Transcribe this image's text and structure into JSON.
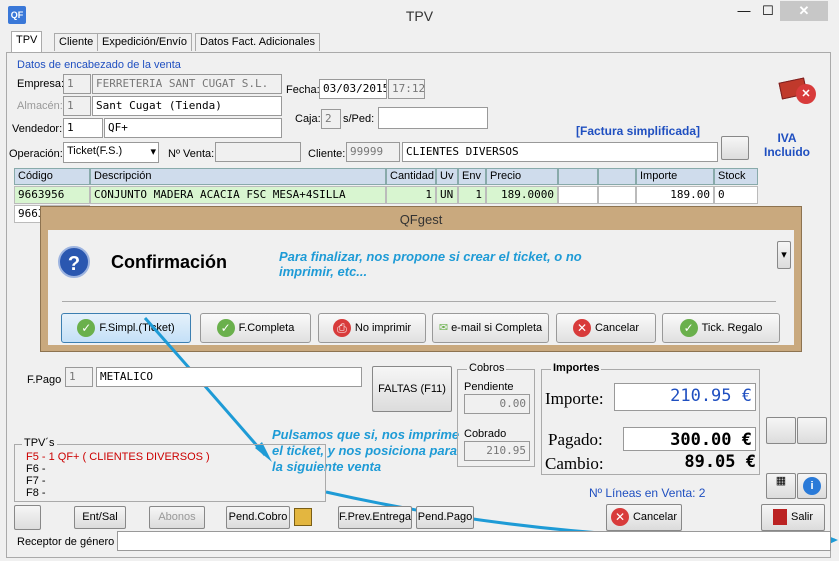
{
  "window": {
    "title": "TPV",
    "app_icon_text": "QF",
    "close": "✕",
    "minimize": "—",
    "maximize": "☐"
  },
  "tabs": [
    "TPV",
    "Cliente",
    "Expedición/Envío",
    "Datos Fact. Adicionales"
  ],
  "header": {
    "section_title": "Datos de encabezado de la venta",
    "empresa_label": "Empresa:",
    "empresa_code": "1",
    "empresa_name": "FERRETERIA SANT CUGAT S.L.",
    "almacen_label": "Almacén:",
    "almacen_code": "1",
    "almacen_name": "Sant Cugat (Tienda)",
    "vendedor_label": "Vendedor:",
    "vendedor_code": "1",
    "vendedor_name": "QF+",
    "fecha_label": "Fecha:",
    "fecha": "03/03/2015",
    "hora": "17:12",
    "caja_label": "Caja:",
    "caja": "2",
    "sped_label": "s/Ped:",
    "sped": "",
    "operacion_label": "Operación:",
    "operacion": "Ticket(F.S.)",
    "nventa_label": "Nº Venta:",
    "nventa": "",
    "cliente_label": "Cliente:",
    "cliente_code": "99999",
    "cliente_name": "CLIENTES DIVERSOS",
    "factura_simplificada": "[Factura simplificada]",
    "iva_incluido": "IVA Incluido"
  },
  "grid": {
    "headers": [
      "Código",
      "Descripción",
      "Cantidad",
      "Uv",
      "Env",
      "Precio",
      "",
      "",
      "Importe",
      "Stock"
    ],
    "rows": [
      [
        "9663956",
        "CONJUNTO MADERA ACACIA FSC MESA+4SILLA",
        "1",
        "UN",
        "1",
        "189.0000",
        "",
        "",
        "189.00",
        "0"
      ],
      [
        "9663",
        "",
        "",
        "",
        "",
        "",
        "",
        "",
        "",
        ""
      ]
    ]
  },
  "dialog": {
    "title": "QFgest",
    "heading": "Confirmación",
    "buttons": [
      "F.Simpl.(Ticket)",
      "F.Completa",
      "No imprimir",
      "e-mail si Completa",
      "Cancelar",
      "Tick. Regalo"
    ]
  },
  "annotations": {
    "top": "Para finalizar, nos propone si crear el ticket, o no imprimir, etc...",
    "bottom": "Pulsamos que si, nos imprime el ticket, y nos posiciona para la siguiente venta"
  },
  "pago": {
    "label": "F.Pago",
    "code": "1",
    "name": "METALICO",
    "faltas": "FALTAS (F11)"
  },
  "cobros": {
    "title": "Cobros",
    "pendiente_label": "Pendiente",
    "pendiente": "0.00",
    "cobrado_label": "Cobrado",
    "cobrado": "210.95"
  },
  "importes": {
    "title": "Importes",
    "importe_label": "Importe:",
    "importe": "210.95 €",
    "pagado_label": "Pagado:",
    "pagado": "300.00 €",
    "cambio_label": "Cambio:",
    "cambio": "89.05 €",
    "lineas": "Nº Líneas en Venta: 2"
  },
  "tpvs": {
    "title": "TPV´s",
    "lines": [
      "F5 - 1 QF+ ( CLIENTES DIVERSOS )",
      "F6 -",
      "F7 -",
      "F8 -"
    ]
  },
  "bottom_buttons": [
    "Ent/Sal",
    "Abonos",
    "Pend.Cobro",
    "F.Prev.Entrega",
    "Pend.Pago",
    "Cancelar",
    "Salir"
  ],
  "receptor_label": "Receptor de género",
  "colors": {
    "accent": "#1f4fc0",
    "dialog_frame": "#c9a97e",
    "selected_row": "#d8f5d0",
    "annotation": "#1e9bd6"
  }
}
